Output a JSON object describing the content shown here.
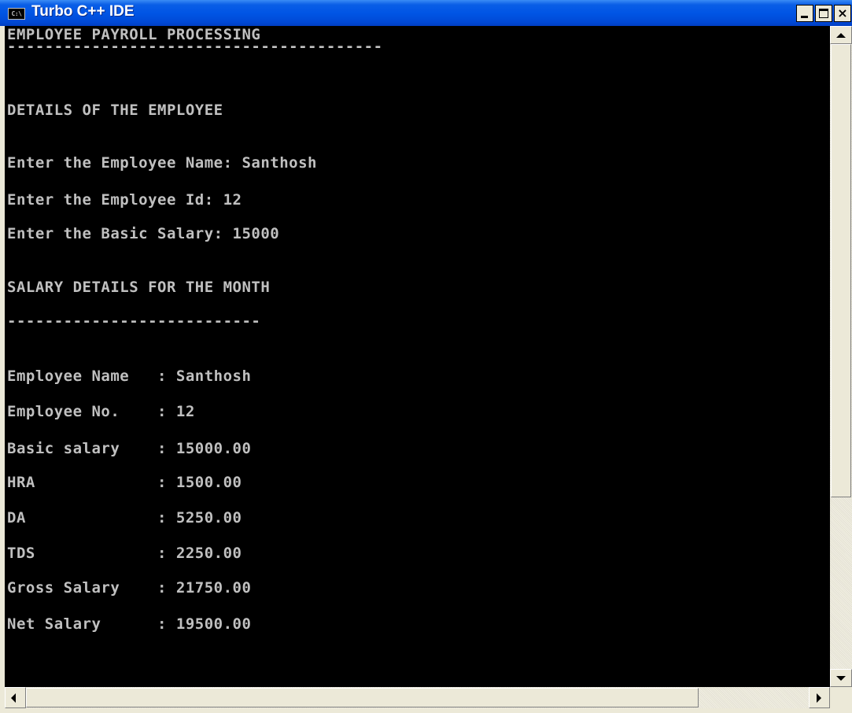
{
  "window": {
    "title": "Turbo C++ IDE",
    "icon_text": "C:\\"
  },
  "console": {
    "lines": [
      "EMPLOYEE PAYROLL PROCESSING",
      "----------------------------------------",
      "DETAILS OF THE EMPLOYEE",
      "Enter the Employee Name: Santhosh",
      "Enter the Employee Id: 12",
      "Enter the Basic Salary: 15000",
      "SALARY DETAILS FOR THE MONTH",
      "---------------------------",
      "Employee Name   : Santhosh",
      "Employee No.    : 12",
      "Basic salary    : 15000.00",
      "HRA             : 1500.00",
      "DA              : 5250.00",
      "TDS             : 2250.00",
      "Gross Salary    : 21750.00",
      "Net Salary      : 19500.00"
    ]
  },
  "colors": {
    "console_bg": "#000000",
    "console_text": "#c0c0c0",
    "titlebar": "#0055e5"
  }
}
